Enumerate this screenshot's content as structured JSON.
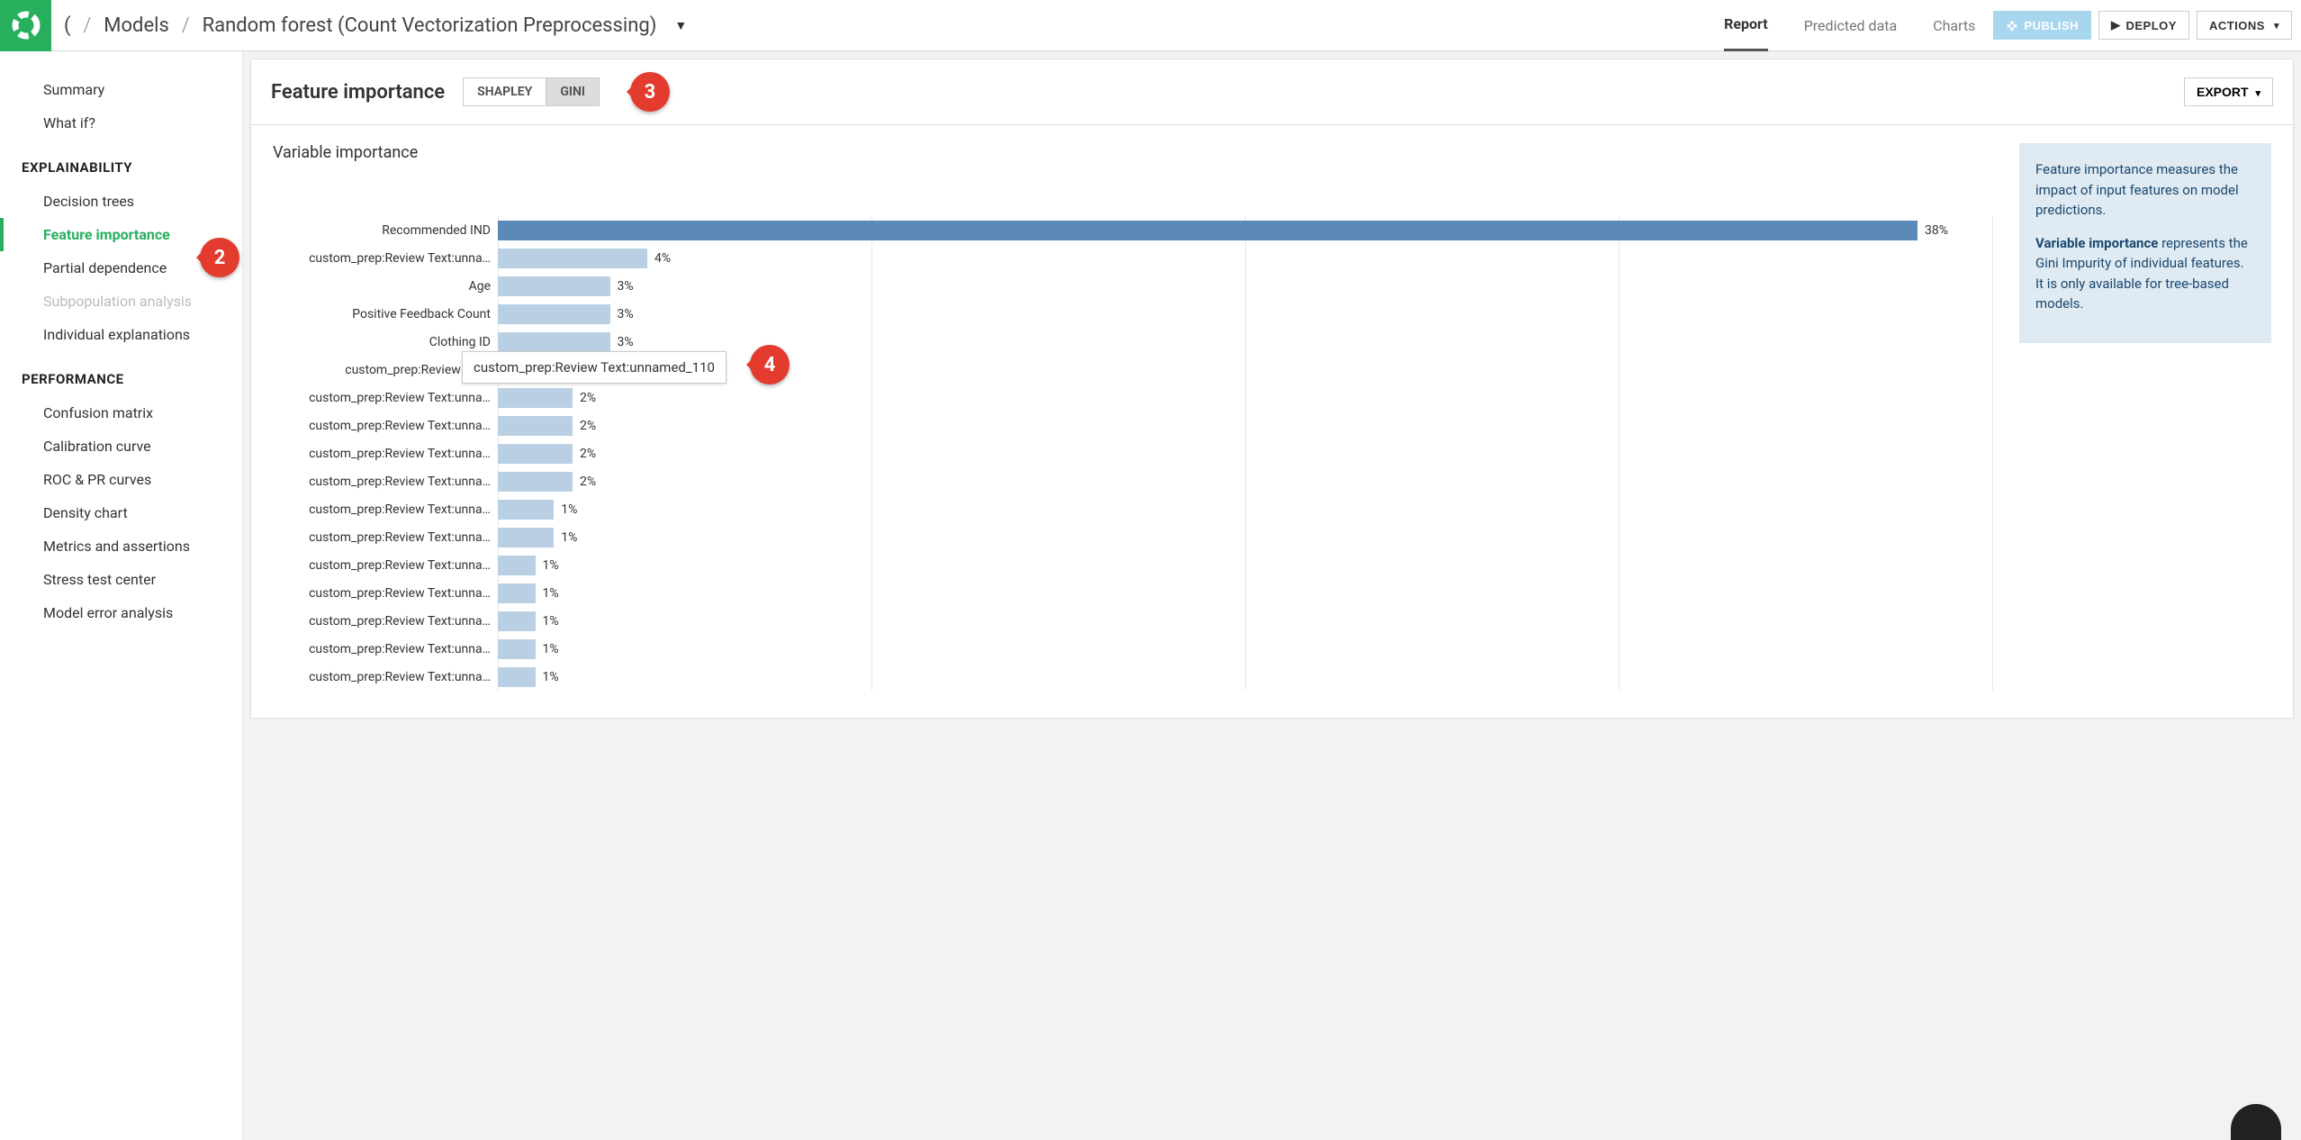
{
  "breadcrumbs": {
    "root_trunc": "(",
    "models": "Models",
    "current": "Random forest (Count Vectorization Preprocessing)"
  },
  "tabs": [
    "Report",
    "Predicted data",
    "Charts"
  ],
  "active_tab": 0,
  "top_buttons": {
    "publish": "PUBLISH",
    "deploy": "DEPLOY",
    "actions": "ACTIONS"
  },
  "sidebar": {
    "items_top": [
      "Summary",
      "What if?"
    ],
    "sections": [
      {
        "title": "EXPLAINABILITY",
        "items": [
          {
            "label": "Decision trees",
            "active": false,
            "disabled": false
          },
          {
            "label": "Feature importance",
            "active": true,
            "disabled": false
          },
          {
            "label": "Partial dependence",
            "active": false,
            "disabled": false
          },
          {
            "label": "Subpopulation analysis",
            "active": false,
            "disabled": true
          },
          {
            "label": "Individual explanations",
            "active": false,
            "disabled": false
          }
        ]
      },
      {
        "title": "PERFORMANCE",
        "items": [
          {
            "label": "Confusion matrix",
            "active": false,
            "disabled": false
          },
          {
            "label": "Calibration curve",
            "active": false,
            "disabled": false
          },
          {
            "label": "ROC & PR curves",
            "active": false,
            "disabled": false
          },
          {
            "label": "Density chart",
            "active": false,
            "disabled": false
          },
          {
            "label": "Metrics and assertions",
            "active": false,
            "disabled": false
          },
          {
            "label": "Stress test center",
            "active": false,
            "disabled": false
          },
          {
            "label": "Model error analysis",
            "active": false,
            "disabled": false
          }
        ]
      }
    ]
  },
  "panel": {
    "title": "Feature importance",
    "toggle": {
      "options": [
        "SHAPLEY",
        "GINI"
      ],
      "active": 1
    },
    "export": "EXPORT"
  },
  "chart_data": {
    "type": "bar",
    "title": "Variable importance",
    "xlabel": "",
    "ylabel": "",
    "xlim": [
      0,
      40
    ],
    "categories": [
      "Recommended IND",
      "custom_prep:Review Text:unna…",
      "Age",
      "Positive Feedback Count",
      "Clothing ID",
      "custom_prep:Review Text:",
      "custom_prep:Review Text:unna…",
      "custom_prep:Review Text:unna…",
      "custom_prep:Review Text:unna…",
      "custom_prep:Review Text:unna…",
      "custom_prep:Review Text:unna…",
      "custom_prep:Review Text:unna…",
      "custom_prep:Review Text:unna…",
      "custom_prep:Review Text:unna…",
      "custom_prep:Review Text:unna…",
      "custom_prep:Review Text:unna…",
      "custom_prep:Review Text:unna…"
    ],
    "values": [
      38,
      4,
      3,
      3,
      3,
      2.5,
      2,
      2,
      2,
      2,
      1.5,
      1.5,
      1,
      1,
      1,
      1,
      1
    ],
    "value_labels": [
      "38%",
      "4%",
      "3%",
      "3%",
      "3%",
      "",
      "2%",
      "2%",
      "2%",
      "2%",
      "1%",
      "1%",
      "1%",
      "1%",
      "1%",
      "1%",
      "1%"
    ],
    "bar_color_main": "#5c8ab8",
    "bar_color_rest": "#b9d0e4"
  },
  "tooltip": {
    "text": "custom_prep:Review Text:unnamed_110",
    "row_index": 5
  },
  "info": {
    "p1": "Feature importance measures the impact of input features on model predictions.",
    "p2_bold": "Variable importance",
    "p2_rest": " represents the Gini Impurity of individual features. It is only available for tree-based models."
  },
  "callouts": {
    "c2": "2",
    "c3": "3",
    "c4": "4"
  }
}
